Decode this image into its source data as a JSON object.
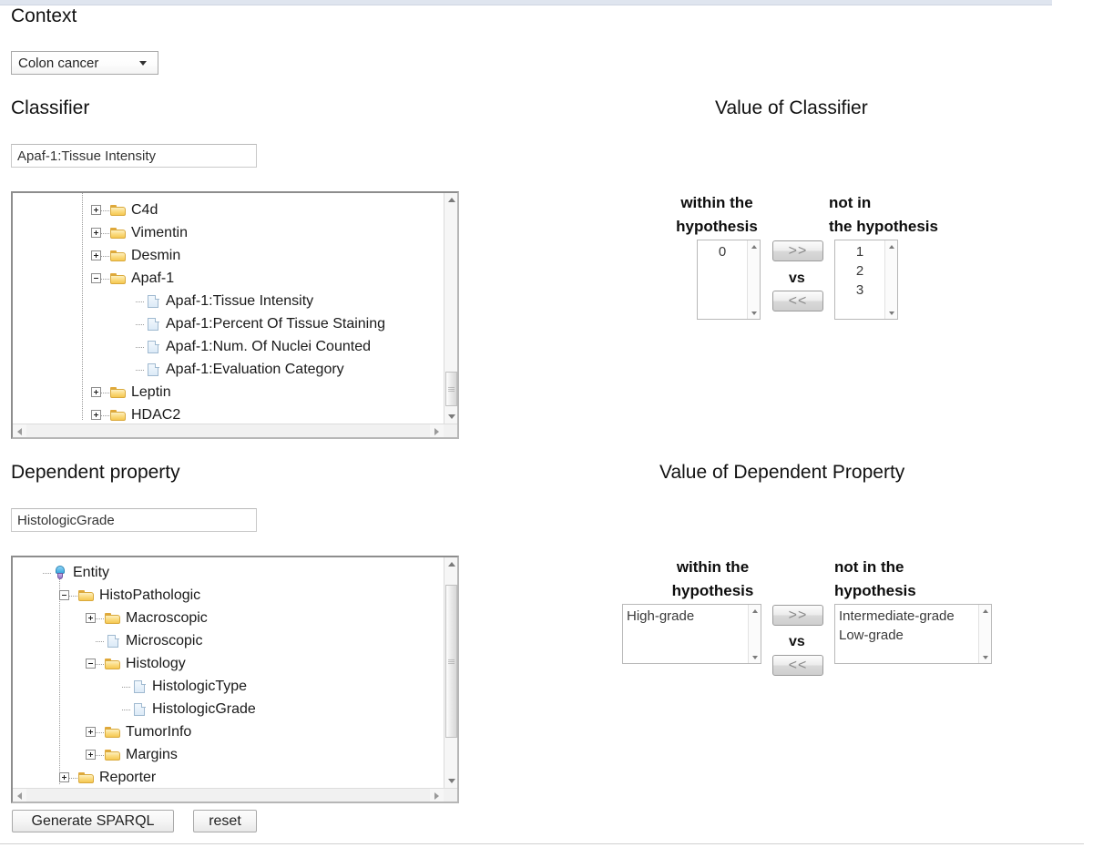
{
  "page": {
    "context_title": "Context",
    "classifier_title": "Classifier",
    "value_of_classifier_title": "Value of Classifier",
    "dependent_property_title": "Dependent property",
    "value_of_dependent_property_title": "Value of Dependent Property"
  },
  "context": {
    "selected": "Colon cancer",
    "caret_icon": "chevron-down-icon"
  },
  "classifier": {
    "input_value": "Apaf-1:Tissue Intensity",
    "tree": [
      {
        "label": "C4d",
        "icon": "folder-icon",
        "state": "collapsed",
        "depth": 1
      },
      {
        "label": "Vimentin",
        "icon": "folder-icon",
        "state": "collapsed",
        "depth": 1
      },
      {
        "label": "Desmin",
        "icon": "folder-icon",
        "state": "collapsed",
        "depth": 1
      },
      {
        "label": "Apaf-1",
        "icon": "folder-icon",
        "state": "expanded",
        "depth": 1
      },
      {
        "label": "Apaf-1:Tissue Intensity",
        "icon": "document-icon",
        "state": "leaf",
        "depth": 2
      },
      {
        "label": "Apaf-1:Percent Of Tissue Staining",
        "icon": "document-icon",
        "state": "leaf",
        "depth": 2
      },
      {
        "label": "Apaf-1:Num. Of Nuclei Counted",
        "icon": "document-icon",
        "state": "leaf",
        "depth": 2
      },
      {
        "label": "Apaf-1:Evaluation Category",
        "icon": "document-icon",
        "state": "leaf",
        "depth": 2
      },
      {
        "label": "Leptin",
        "icon": "folder-icon",
        "state": "collapsed",
        "depth": 1
      },
      {
        "label": "HDAC2",
        "icon": "folder-icon",
        "state": "collapsed",
        "depth": 1
      }
    ]
  },
  "classifier_values": {
    "within_label_line1": "within the",
    "within_label_line2": "hypothesis",
    "notin_label_line1": "not in",
    "notin_label_line2": "the hypothesis",
    "within_items": [
      "0"
    ],
    "notin_items": [
      "1",
      "2",
      "3"
    ],
    "move_right_label": ">>",
    "move_left_label": "<<",
    "vs_label": "vs"
  },
  "dependent": {
    "input_value": "HistologicGrade",
    "tree": [
      {
        "label": "Entity",
        "icon": "entity-icon",
        "state": "leaf",
        "depth": 0
      },
      {
        "label": "HistoPathologic",
        "icon": "folder-icon",
        "state": "expanded",
        "depth": 1
      },
      {
        "label": "Macroscopic",
        "icon": "folder-icon",
        "state": "collapsed",
        "depth": 2
      },
      {
        "label": "Microscopic",
        "icon": "document-icon",
        "state": "leaf",
        "depth": 2
      },
      {
        "label": "Histology",
        "icon": "folder-icon",
        "state": "expanded",
        "depth": 2
      },
      {
        "label": "HistologicType",
        "icon": "document-icon",
        "state": "leaf",
        "depth": 3
      },
      {
        "label": "HistologicGrade",
        "icon": "document-icon",
        "state": "leaf",
        "depth": 3
      },
      {
        "label": "TumorInfo",
        "icon": "folder-icon",
        "state": "collapsed",
        "depth": 2
      },
      {
        "label": "Margins",
        "icon": "folder-icon",
        "state": "collapsed",
        "depth": 2
      },
      {
        "label": "Reporter",
        "icon": "folder-icon",
        "state": "collapsed",
        "depth": 1
      }
    ]
  },
  "dependent_values": {
    "within_label_line1": "within the",
    "within_label_line2": "hypothesis",
    "notin_label_line1": "not in the",
    "notin_label_line2": "hypothesis",
    "within_items": [
      "High-grade"
    ],
    "notin_items": [
      "Intermediate-grade",
      "Low-grade"
    ],
    "move_right_label": ">>",
    "move_left_label": "<<",
    "vs_label": "vs"
  },
  "actions": {
    "generate_label": "Generate SPARQL",
    "reset_label": "reset"
  }
}
